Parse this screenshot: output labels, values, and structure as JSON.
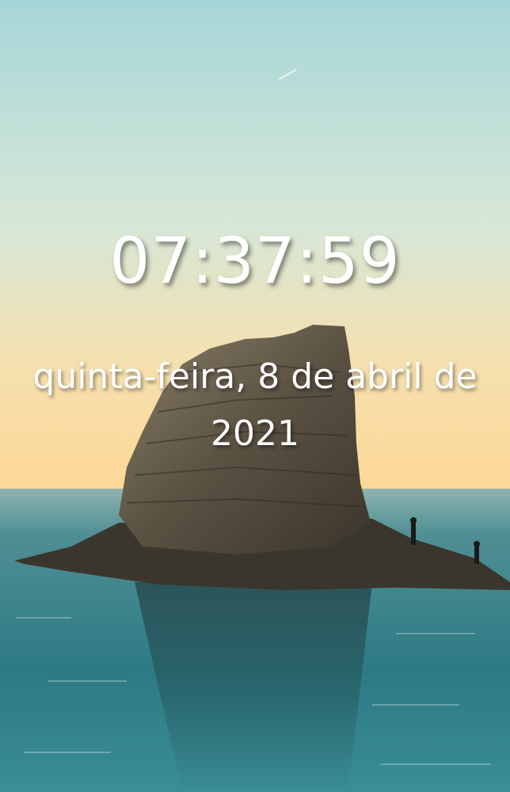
{
  "lock_screen": {
    "time": "07:37:59",
    "date": "quinta-feira, 8 de abril de 2021",
    "wallpaper": {
      "description_icon": "sea-rock-wallpaper",
      "colors": {
        "sky_top": "#a9d8d9",
        "sky_horizon": "#fcd89b",
        "sea": "#2f7e86",
        "rock": "#5a5243"
      }
    }
  }
}
